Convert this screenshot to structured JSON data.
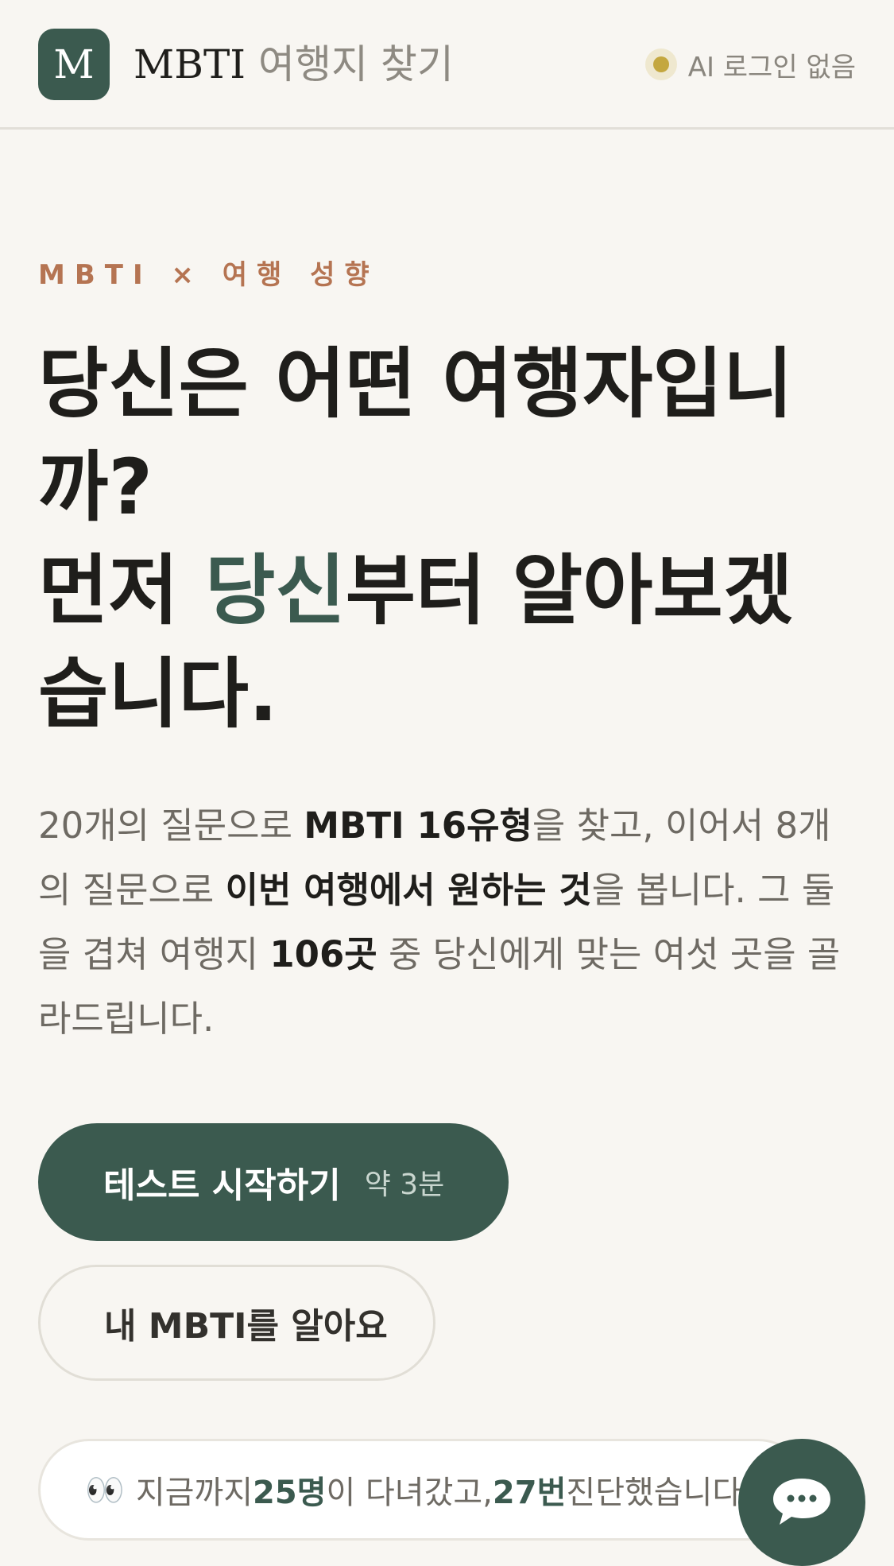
{
  "header": {
    "logo_letter": "M",
    "brand_main": "MBTI",
    "brand_sub": "여행지 찾기",
    "status_text": "AI 로그인 없음",
    "status_dot_color": "#c4a73f"
  },
  "hero": {
    "eyebrow": "MBTI × 여행 성향",
    "headline_line1": "당신은 어떤 여행자입니까?",
    "headline_line2_before": "먼저 ",
    "headline_line2_accent": "당신",
    "headline_line2_after": "부터 알아보겠습니다.",
    "description": {
      "part1": "20개의 질문으로 ",
      "bold1": "MBTI 16유형",
      "part2": "을 찾고, 이어서 8개의 질문으로 ",
      "bold2": "이번 여행에서 원하는 것",
      "part3": "을 봅니다. 그 둘을 겹쳐 여행지 ",
      "bold3": "106곳",
      "part4": " 중 당신에게 맞는 여섯 곳을 골라드립니다."
    }
  },
  "actions": {
    "start_label": "테스트 시작하기",
    "start_duration": "약 3분",
    "know_label": "내 MBTI를 알아요"
  },
  "stats": {
    "eyes_icon": "👀",
    "part1": "지금까지 ",
    "visitors": "25명",
    "part2": "이 다녀갔고, ",
    "diagnoses": "27번",
    "part3": " 진단했습니다."
  },
  "colors": {
    "accent": "#3b5a4f",
    "eyebrow": "#b57452",
    "background": "#f8f6f2"
  }
}
